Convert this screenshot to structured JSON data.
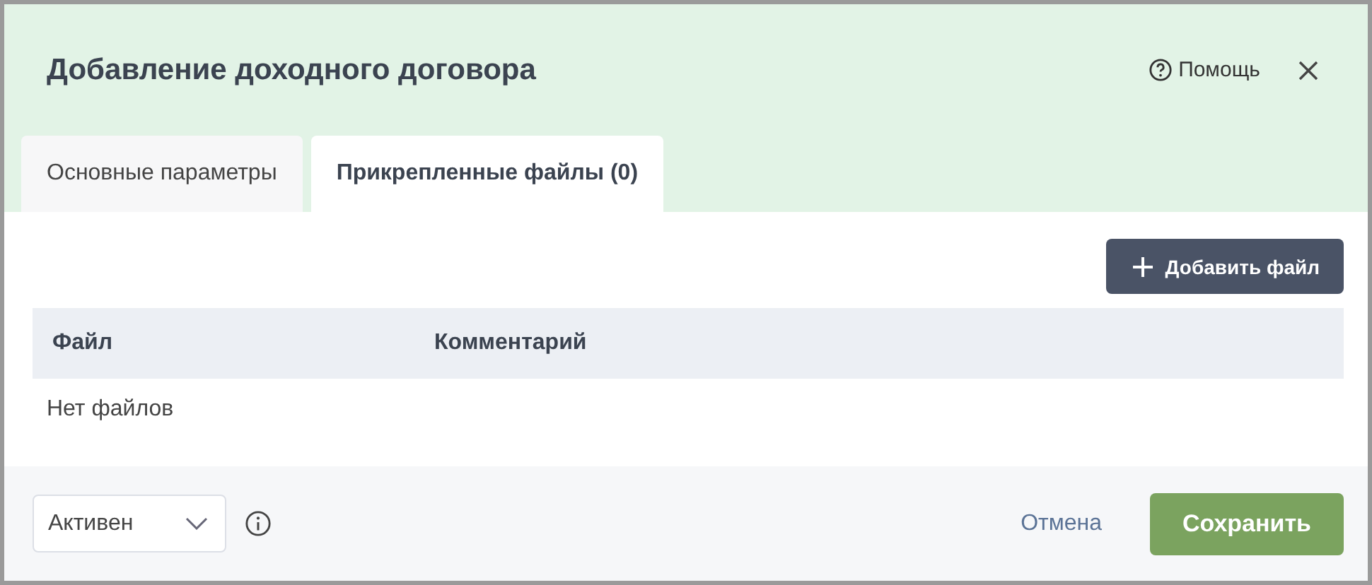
{
  "dialog": {
    "title": "Добавление доходного договора",
    "help": "Помощь"
  },
  "tabs": [
    {
      "label": "Основные параметры",
      "selected": false
    },
    {
      "label": "Прикрепленные файлы (0)",
      "selected": true
    }
  ],
  "add_button": "Добавить файл",
  "table": {
    "columns": [
      "Файл",
      "Комментарий"
    ],
    "empty_text": "Нет файлов"
  },
  "footer": {
    "status": "Активен",
    "cancel": "Отмена",
    "save": "Сохранить"
  }
}
